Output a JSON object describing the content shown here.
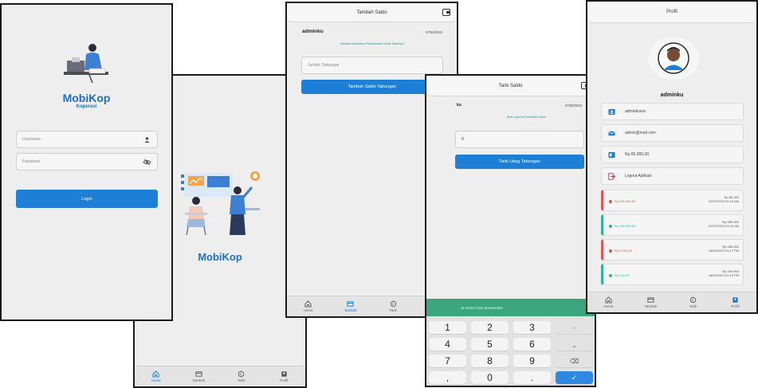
{
  "login": {
    "app_name": "MobiKop",
    "subtitle": "Koperasi",
    "username_placeholder": "Username",
    "password_placeholder": "Password",
    "login_label": "Login"
  },
  "splash": {
    "app_name": "MobiKop",
    "nav": [
      "Home",
      "Tambah",
      "Tarik",
      "Profil"
    ]
  },
  "tambah": {
    "title": "Tambah Saldo",
    "username": "adminku",
    "date": "07/02/2023",
    "info": "Silahkan Masukkan Penambahan Untuk Saldonya",
    "amount_placeholder": "Jumlah Tabungan",
    "submit_label": "Tambah Saldo Tabungan",
    "nav": [
      "Home",
      "Tambah",
      "Tarik",
      "Profil"
    ]
  },
  "tarik": {
    "title": "Tarik Saldo",
    "username": "ku",
    "date": "07/02/2023",
    "info": "Buat Laporan Penarikan Saldo",
    "amount_value": "0",
    "submit_label": "Tarik Uang Tabungan",
    "toast": "...la terkecil dari pemasukan",
    "keys": [
      "1",
      "2",
      "3",
      "-",
      "4",
      "5",
      "6",
      "⎵",
      "7",
      "8",
      "9",
      "⌫",
      ",",
      "0",
      ".",
      "✓"
    ]
  },
  "profil": {
    "title": "Profil",
    "username": "adminku",
    "menu": [
      {
        "icon": "id-card-icon",
        "label": "adminkuxxx"
      },
      {
        "icon": "mail-icon",
        "label": "admin@mail.com"
      },
      {
        "icon": "wallet-icon",
        "label": "Rp 85.000,00"
      },
      {
        "icon": "logout-icon",
        "label": "Logout Aplikasi"
      }
    ],
    "transactions": [
      {
        "type": "out",
        "amount": "Rp 500.000,00",
        "balance": "Rp 85.000",
        "datetime": "02/07/2023 01:24 AM"
      },
      {
        "type": "in",
        "amount": "Rp 100.000,00",
        "balance": "Rp 585.000",
        "datetime": "02/07/2023 01:24 AM"
      },
      {
        "type": "out",
        "amount": "Rp 5.000,00",
        "balance": "Rp 485.000",
        "datetime": "16/05/2023 01:17 PM"
      },
      {
        "type": "in",
        "amount": "Rp 400.00",
        "balance": "Rp 490.000",
        "datetime": "16/05/2023 01:13 PM"
      }
    ],
    "nav": [
      "Home",
      "Tambah",
      "Tarik",
      "Profil"
    ]
  },
  "colors": {
    "primary": "#1e7fd6",
    "teal": "#1c9b8a",
    "out": "#e05555",
    "in": "#2fb39a",
    "toast": "#3aa57e"
  }
}
